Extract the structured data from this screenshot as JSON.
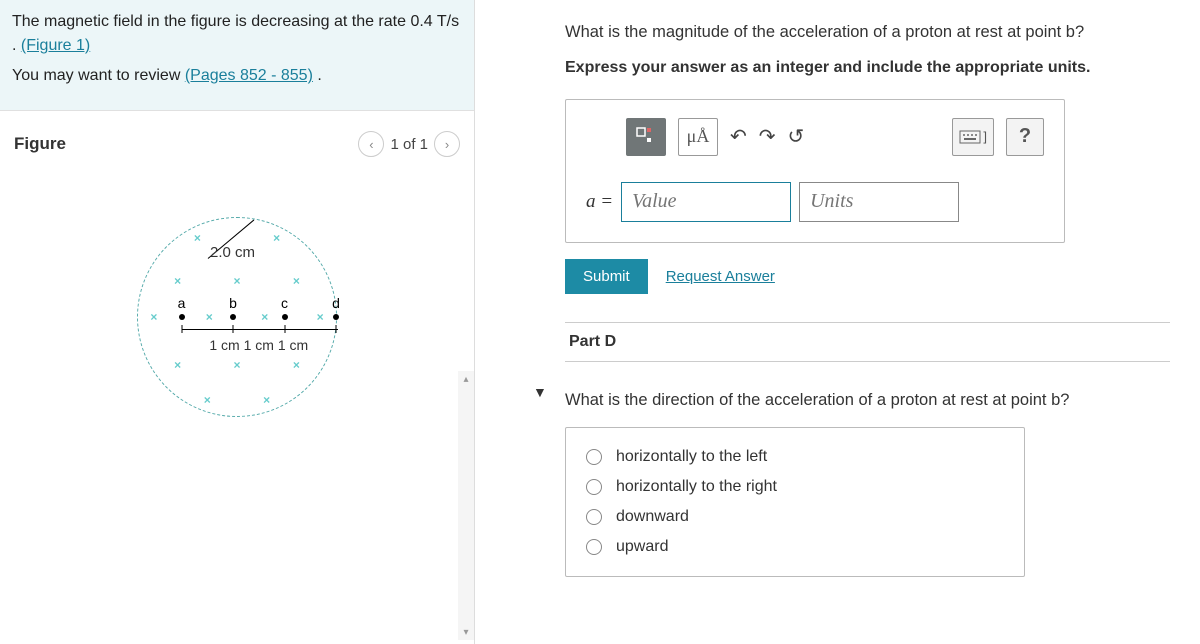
{
  "info": {
    "prompt_text_1": "The magnetic field in the figure is decreasing at the rate 0.4 T/s . ",
    "figure_link": "(Figure 1)",
    "review_prefix": "You may want to review ",
    "review_link": "(Pages 852 - 855)",
    "review_suffix": " ."
  },
  "figure": {
    "title": "Figure",
    "counter": "1 of 1",
    "radius_label": "2.0 cm",
    "points": [
      "a",
      "b",
      "c",
      "d"
    ],
    "segment_label": "1 cm  1 cm  1 cm"
  },
  "partC": {
    "question": "What is the magnitude of the acceleration of a proton at rest at point b?",
    "instruction": "Express your answer as an integer and include the appropriate units.",
    "mu_label": "μÅ",
    "keyboard_label": "]",
    "help_label": "?",
    "var_label": "a =",
    "value_placeholder": "Value",
    "units_placeholder": "Units",
    "submit": "Submit",
    "request": "Request Answer"
  },
  "partD": {
    "header": "Part D",
    "question": "What is the direction of the acceleration of a proton at rest at point b?",
    "options": [
      "horizontally to the left",
      "horizontally to the right",
      "downward",
      "upward"
    ]
  }
}
